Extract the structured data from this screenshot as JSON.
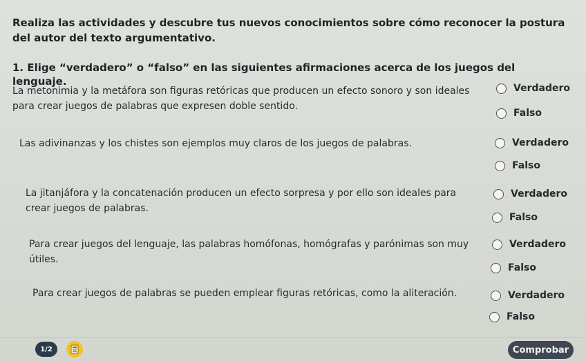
{
  "intro": "Realiza las actividades y descubre tus nuevos conocimientos sobre cómo reconocer la postura del autor del texto argumentativo.",
  "question_title": "1. Elige “verdadero” o “falso” en las siguientes afirmaciones acerca de los juegos del lenguaje.",
  "items": [
    {
      "statement": "La metonimia y la metáfora son figuras retóricas que producen un efecto sonoro y son ideales para crear juegos de palabras que expresen doble sentido.",
      "true_label": "Verdadero",
      "false_label": "Falso"
    },
    {
      "statement": "Las adivinanzas y los chistes son ejemplos muy claros de los juegos de palabras.",
      "true_label": "Verdadero",
      "false_label": "Falso"
    },
    {
      "statement": "La jitanjáfora y la concatenación producen un efecto sorpresa y por ello son ideales para crear juegos de palabras.",
      "true_label": "Verdadero",
      "false_label": "Falso"
    },
    {
      "statement": "Para crear juegos del lenguaje, las palabras homófonas, homógrafas y parónimas son muy útiles.",
      "true_label": "Verdadero",
      "false_label": "Falso"
    },
    {
      "statement": "Para crear juegos de palabras se pueden emplear figuras retóricas, como la aliteración.",
      "true_label": "Verdadero",
      "false_label": "Falso"
    }
  ],
  "footer": {
    "page_indicator": "1/2",
    "calculator_icon": "calculator-icon",
    "check_button": "Comprobar"
  }
}
